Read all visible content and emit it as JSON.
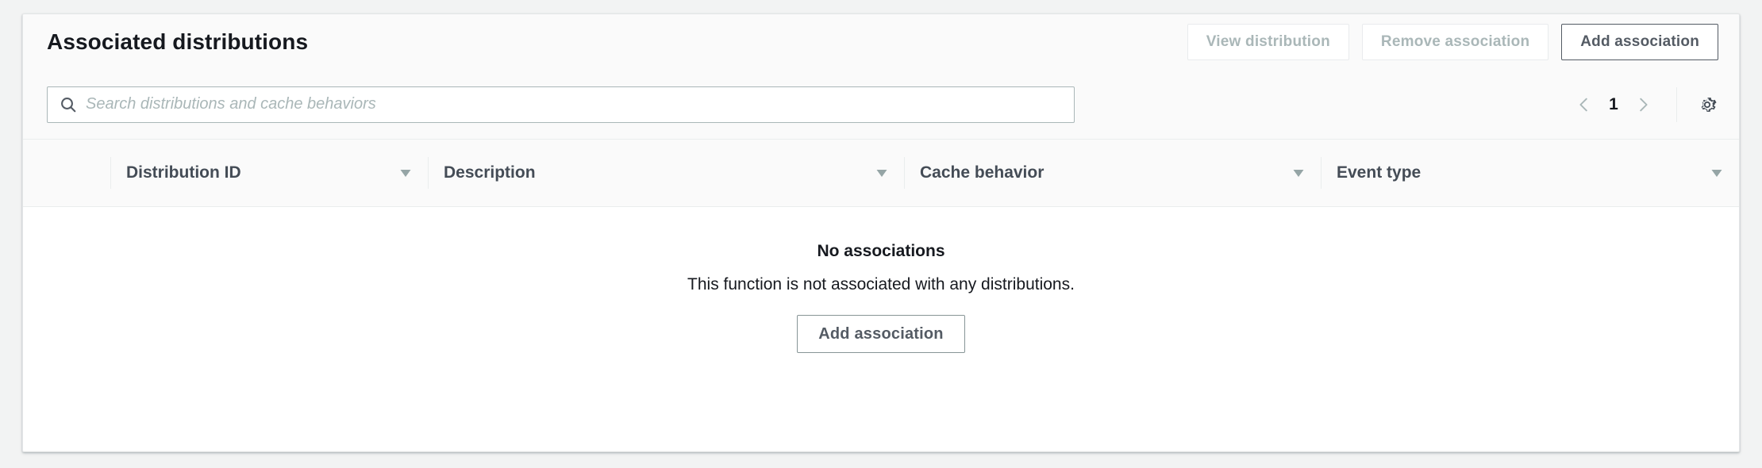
{
  "panel": {
    "title": "Associated distributions"
  },
  "header": {
    "buttons": [
      {
        "label": "View distribution",
        "name": "view-distribution-button",
        "disabled": true
      },
      {
        "label": "Remove association",
        "name": "remove-association-button",
        "disabled": true
      },
      {
        "label": "Add association",
        "name": "add-association-button",
        "disabled": false
      }
    ]
  },
  "search": {
    "placeholder": "Search distributions and cache behaviors",
    "value": "",
    "icon": "search-icon"
  },
  "pagination": {
    "previous_icon": "chevron-left-icon",
    "current_page": "1",
    "next_icon": "chevron-right-icon",
    "settings_icon": "gear-icon"
  },
  "table": {
    "columns": [
      {
        "label": "Distribution ID",
        "sort_icon": "sort-descending-icon"
      },
      {
        "label": "Description",
        "sort_icon": "sort-descending-icon"
      },
      {
        "label": "Cache behavior",
        "sort_icon": "sort-descending-icon"
      },
      {
        "label": "Event type",
        "sort_icon": "sort-descending-icon"
      }
    ],
    "rows": [],
    "empty_state": {
      "title": "No associations",
      "description": "This function is not associated with any distributions.",
      "action_label": "Add association"
    }
  },
  "colors": {
    "page_background": "#f2f3f3",
    "panel_background": "#fafafa",
    "table_body_background": "#ffffff",
    "text_primary": "#16191f",
    "text_secondary": "#545b64",
    "text_disabled": "#aab7b8",
    "border": "#eaeded",
    "input_border": "#aab7b8",
    "sort_icon": "#95a5a6"
  }
}
